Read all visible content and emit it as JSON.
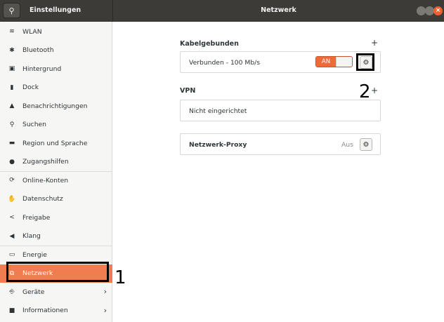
{
  "header": {
    "search_icon": "search-icon",
    "left_title": "Einstellungen",
    "center_title": "Netzwerk",
    "close_symbol": "×"
  },
  "sidebar": {
    "items": [
      {
        "label": "WLAN",
        "icon": "wifi-icon",
        "glyph": "≋"
      },
      {
        "label": "Bluetooth",
        "icon": "bluetooth-icon",
        "glyph": "✱"
      },
      {
        "label": "Hintergrund",
        "icon": "display-icon",
        "glyph": "▣"
      },
      {
        "label": "Dock",
        "icon": "dock-icon",
        "glyph": "▮"
      },
      {
        "label": "Benachrichtigungen",
        "icon": "bell-icon",
        "glyph": "▲"
      },
      {
        "label": "Suchen",
        "icon": "search-icon",
        "glyph": "⚲"
      },
      {
        "label": "Region und Sprache",
        "icon": "flag-icon",
        "glyph": "▬"
      },
      {
        "label": "Zugangshilfen",
        "icon": "accessibility-icon",
        "glyph": "●"
      },
      {
        "label": "Online-Konten",
        "icon": "online-accounts-icon",
        "glyph": "⟳"
      },
      {
        "label": "Datenschutz",
        "icon": "hand-icon",
        "glyph": "✋"
      },
      {
        "label": "Freigabe",
        "icon": "share-icon",
        "glyph": "<"
      },
      {
        "label": "Klang",
        "icon": "speaker-icon",
        "glyph": "◀"
      },
      {
        "label": "Energie",
        "icon": "battery-icon",
        "glyph": "▭"
      },
      {
        "label": "Netzwerk",
        "icon": "network-icon",
        "glyph": "⧉"
      },
      {
        "label": "Geräte",
        "icon": "devices-icon",
        "glyph": "⎆",
        "chevron": "›"
      },
      {
        "label": "Informationen",
        "icon": "info-icon",
        "glyph": "■",
        "chevron": "›"
      }
    ],
    "active_label": "Netzwerk"
  },
  "content": {
    "wired": {
      "title": "Kabelgebunden",
      "add_symbol": "+",
      "connection_label": "Verbunden - 100 Mb/s",
      "toggle_label": "AN",
      "toggle_state": true
    },
    "vpn": {
      "title": "VPN",
      "add_symbol": "+",
      "empty_label": "Nicht eingerichtet"
    },
    "proxy": {
      "title": "Netzwerk-Proxy",
      "status": "Aus"
    }
  },
  "annotations": {
    "one": "1",
    "two": "2"
  },
  "colors": {
    "header_bg": "#3c3b37",
    "accent": "#ef7d4f",
    "toggle_on": "#ef6a3a",
    "sidebar_bg": "#f6f6f5"
  }
}
